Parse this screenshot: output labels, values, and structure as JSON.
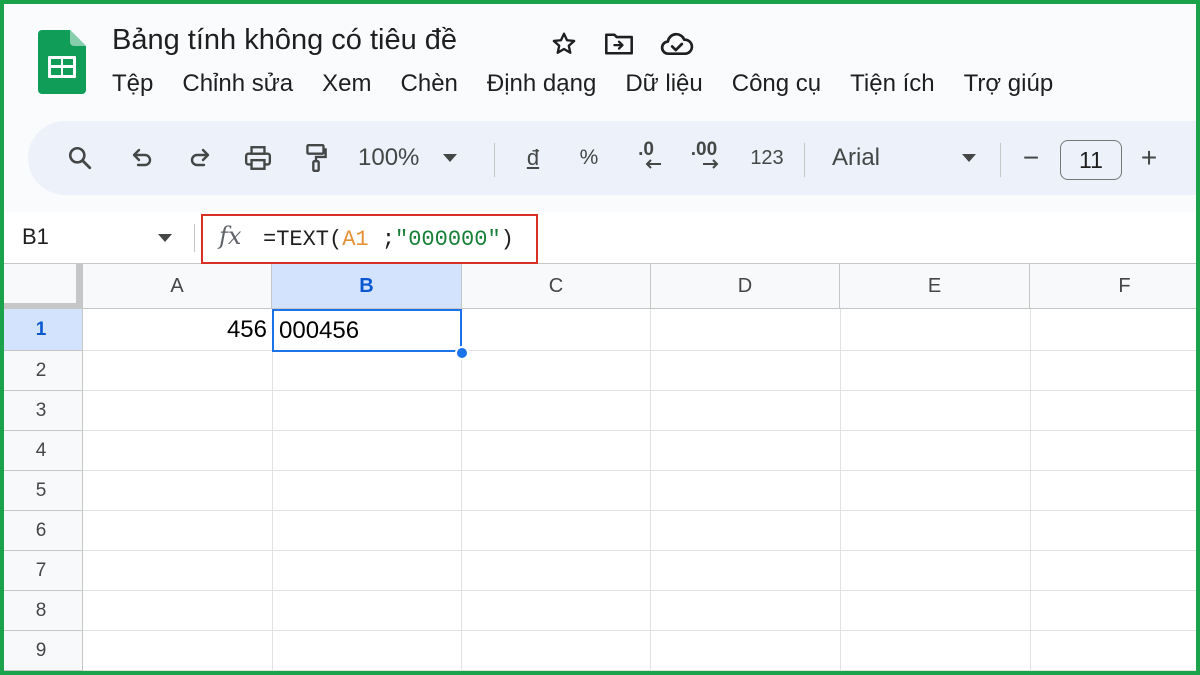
{
  "app": {
    "title": "Bảng tính không có tiêu đề",
    "brand_color": "#0f9d58"
  },
  "menu": [
    "Tệp",
    "Chỉnh sửa",
    "Xem",
    "Chèn",
    "Định dạng",
    "Dữ liệu",
    "Công cụ",
    "Tiện ích",
    "Trợ giúp"
  ],
  "toolbar": {
    "zoom": "100%",
    "currency": "đ",
    "percent": "%",
    "decrease_decimal": ".0",
    "increase_decimal": ".00",
    "number_format": "123",
    "font": "Arial",
    "font_size": "11",
    "decrease_font": "−",
    "increase_font": "+",
    "icons": [
      "search-icon",
      "undo-icon",
      "redo-icon",
      "print-icon",
      "paint-format-icon"
    ]
  },
  "formula_bar": {
    "name_box": "B1",
    "fx": "fx",
    "formula_prefix": "=TEXT(",
    "formula_ref": "A1",
    "formula_sep": " ;",
    "formula_string": "\"000000\"",
    "formula_suffix": ")",
    "highlight_color": "#d93025"
  },
  "grid": {
    "columns": [
      "A",
      "B",
      "C",
      "D",
      "E",
      "F"
    ],
    "rows": [
      "1",
      "2",
      "3",
      "4",
      "5",
      "6",
      "7",
      "8",
      "9"
    ],
    "selected_column": "B",
    "selected_row": "1",
    "cells": {
      "A1": "456",
      "B1": "000456"
    },
    "selection_color": "#1a73e8"
  }
}
